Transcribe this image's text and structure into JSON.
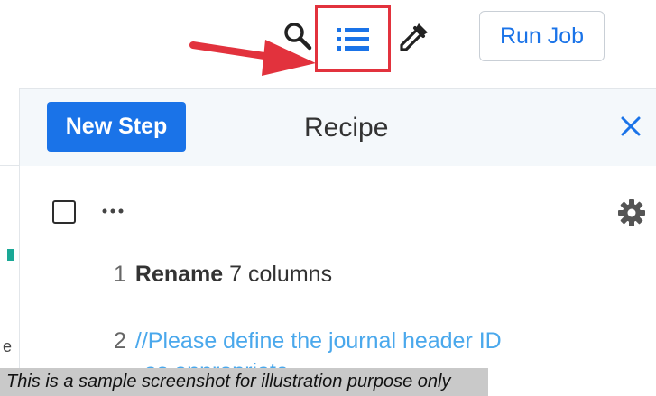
{
  "toolbar": {
    "run_job_label": "Run Job",
    "icons": [
      "search-icon",
      "recipe-list-icon",
      "eyedropper-icon"
    ]
  },
  "left_strip": {
    "partial_text": "e"
  },
  "recipe_panel": {
    "new_step_label": "New Step",
    "title": "Recipe",
    "close_icon": "close-icon",
    "more_icon": "more-horizontal-icon",
    "settings_icon": "gear-icon",
    "steps": [
      {
        "number": "1",
        "command": "Rename",
        "detail": "7 columns"
      },
      {
        "number": "2",
        "comment": "//Please define the journal header ID",
        "comment_continued": "as appropriate"
      }
    ]
  },
  "disclaimer": "This is a sample screenshot for illustration purpose only",
  "colors": {
    "accent_blue": "#1a73e8",
    "comment_blue": "#4aa8ec",
    "highlight_red": "#e2323d",
    "header_bg": "#f4f8fb",
    "teal_marker": "#1aa896"
  }
}
